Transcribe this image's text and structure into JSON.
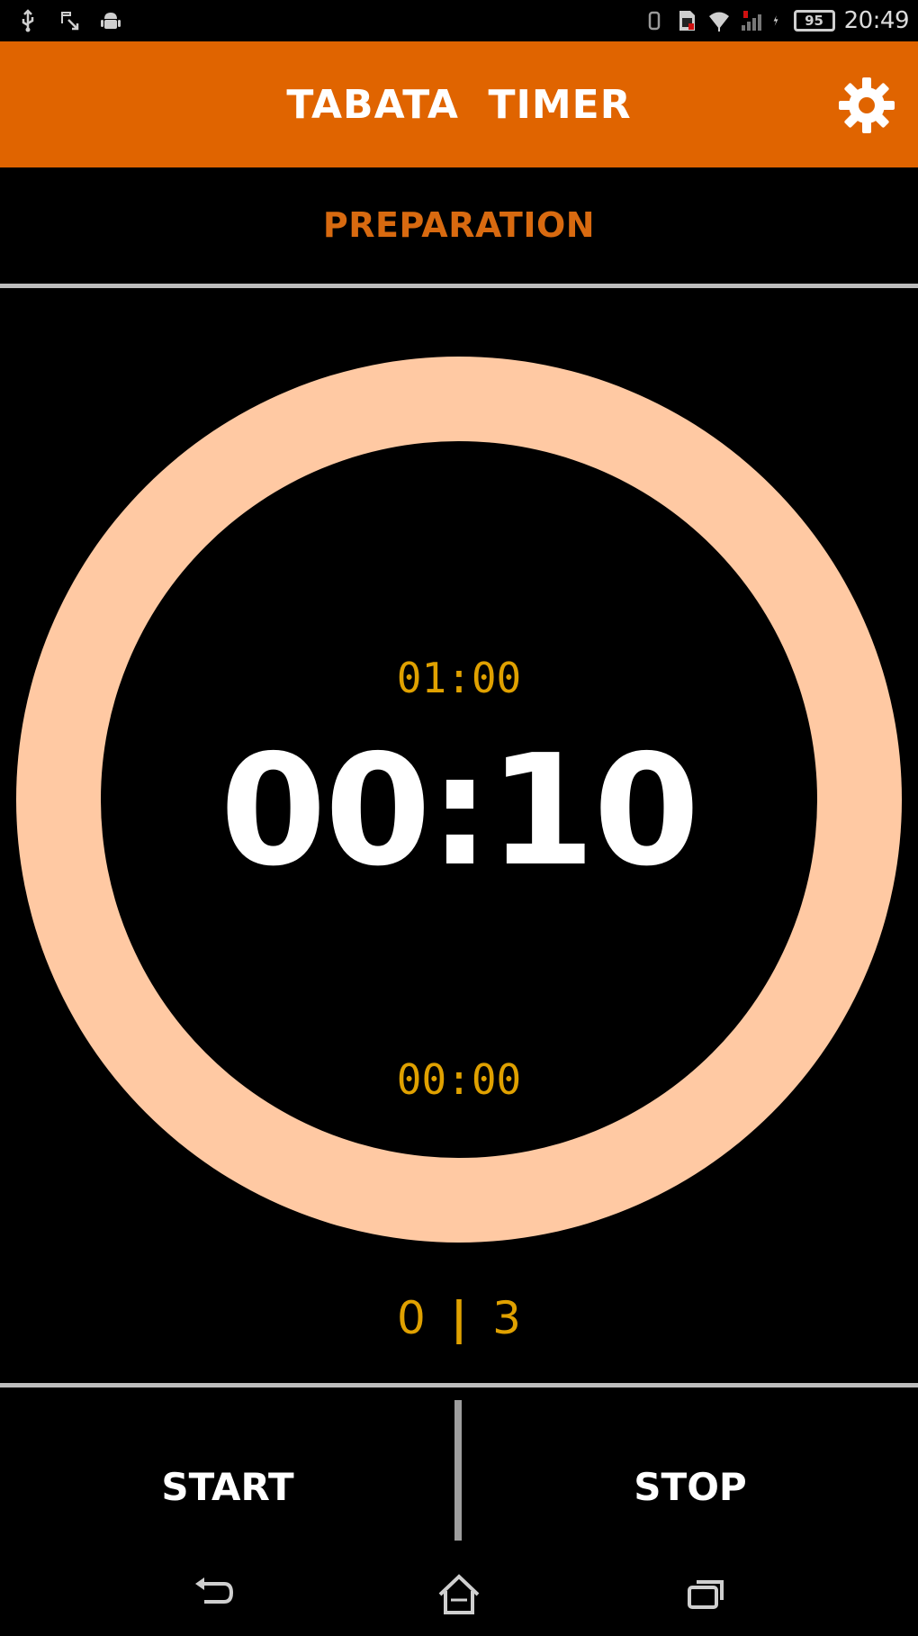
{
  "status_bar": {
    "left_icons": [
      "usb-icon",
      "data-transfer-icon",
      "android-icon"
    ],
    "right_icons": [
      "vibrate-icon",
      "sim-icon",
      "wifi-icon",
      "signal-icon",
      "charging-icon"
    ],
    "battery": "95",
    "time": "20:49"
  },
  "app_bar": {
    "title": "TABATA  TIMER",
    "settings_icon": "gear-icon",
    "color": "#e06400"
  },
  "phase": {
    "label": "PREPARATION",
    "color": "#d86a10"
  },
  "timer": {
    "total": "01:00",
    "current": "00:10",
    "elapsed": "00:00",
    "ring_color": "#ffc9a3",
    "accent_color": "#e0a100"
  },
  "rounds": {
    "current": "0",
    "separator": "|",
    "total": "3"
  },
  "controls": {
    "start_label": "START",
    "stop_label": "STOP"
  },
  "nav_bar": {
    "icons": [
      "back-icon",
      "home-icon",
      "recent-apps-icon"
    ]
  }
}
